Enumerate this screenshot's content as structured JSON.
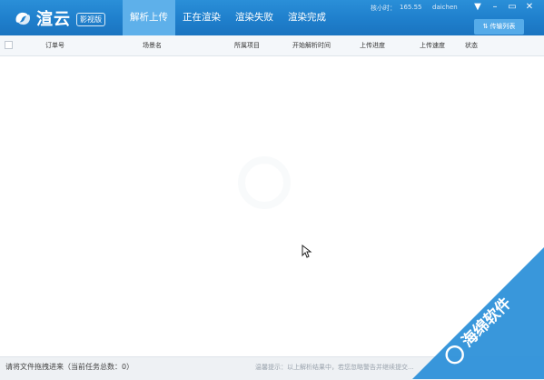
{
  "app": {
    "logo_text": "渲云",
    "logo_badge": "影视版"
  },
  "tabs": [
    {
      "label": "解析上传",
      "active": true
    },
    {
      "label": "正在渲染",
      "active": false
    },
    {
      "label": "渲染失败",
      "active": false
    },
    {
      "label": "渲染完成",
      "active": false
    }
  ],
  "status": {
    "balance_label": "核小时：",
    "balance_value": "165.55",
    "username": "daichen"
  },
  "transfer_button": "传输列表",
  "table": {
    "columns": [
      "订单号",
      "场景名",
      "所属项目",
      "开始解析时间",
      "上传进度",
      "上传速度",
      "状态"
    ]
  },
  "footer": {
    "left_text": "请将文件拖拽进来（当前任务总数：0）",
    "right_text": "温馨提示：以上解析结果中，若您忽略警告并继续提交..."
  },
  "watermark": {
    "text": "海绵软件",
    "color": "#2a8fd8"
  }
}
